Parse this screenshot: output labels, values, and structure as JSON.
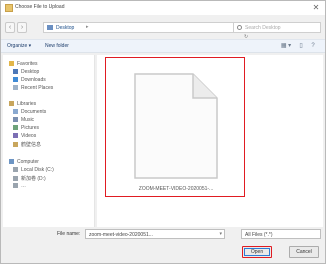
{
  "window": {
    "title": "Choose File to Upload",
    "close_glyph": "✕"
  },
  "address": {
    "back_glyph": "‹",
    "forward_glyph": "›",
    "path": "Desktop",
    "chevron": "▸",
    "arrows": "▾ ↻",
    "search_placeholder": "Search Desktop"
  },
  "toolbar": {
    "organize": "Organize ▾",
    "new_folder": "New folder",
    "view_glyph": "▦ ▾",
    "pane_glyph": "▯",
    "help_glyph": "?"
  },
  "nav": {
    "favorites": "Favorites",
    "desktop": "Desktop",
    "downloads": "Downloads",
    "recent": "Recent Places",
    "libraries": "Libraries",
    "documents": "Documents",
    "music": "Music",
    "pictures": "Pictures",
    "videos": "Videos",
    "cjk": "鹤壁信息",
    "computer": "Computer",
    "local_disk": "Local Disk (C:)",
    "drive2": "新加卷 (D:)",
    "drive3": "…"
  },
  "file": {
    "name": "ZOOM-MEET-VIDEO-2020051-..."
  },
  "bottom": {
    "filename_label": "File name:",
    "filename_value": "zoom-meet-video-2020051...",
    "filename_arrow": "▾",
    "filter_value": "All Files (*.*)",
    "open_label": "Open",
    "cancel_label": "Cancel"
  },
  "colors": {
    "highlight": "#e01b22",
    "focus": "#2e7bd3"
  }
}
